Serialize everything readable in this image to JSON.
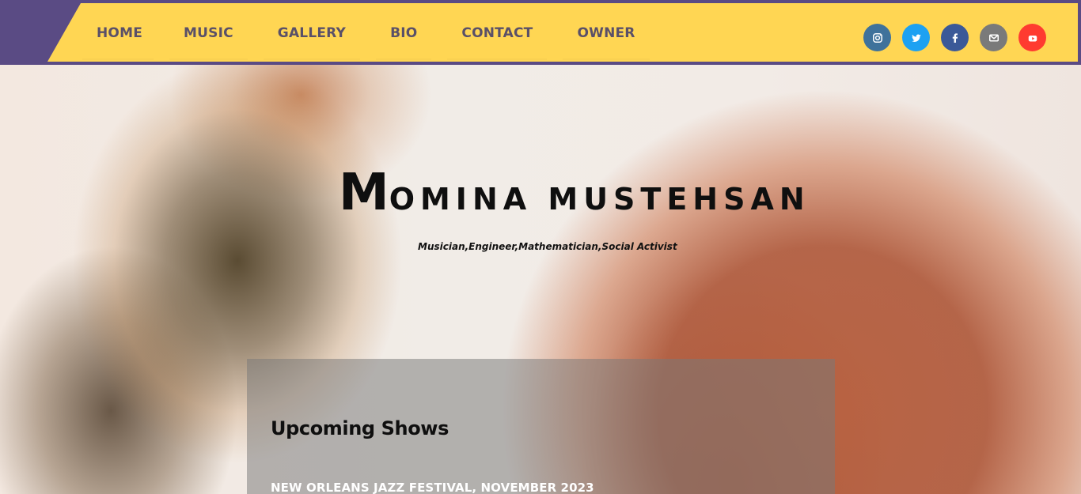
{
  "nav": {
    "items": [
      {
        "label": "HOME"
      },
      {
        "label": "MUSIC"
      },
      {
        "label": "GALLERY"
      },
      {
        "label": "BIO"
      },
      {
        "label": "CONTACT"
      },
      {
        "label": "OWNER"
      }
    ]
  },
  "social": {
    "items": [
      {
        "name": "instagram-icon",
        "color": "#3f729b"
      },
      {
        "name": "twitter-icon",
        "color": "#1da1f2"
      },
      {
        "name": "facebook-icon",
        "color": "#3b5998"
      },
      {
        "name": "mail-icon",
        "color": "#7a7a7a"
      },
      {
        "name": "youtube-icon",
        "color": "#ff3b30"
      }
    ]
  },
  "hero": {
    "title_initial": "M",
    "title_rest": "OMINA MUSTEHSAN",
    "tagline": "Musician,Engineer,Mathematician,Social Activist"
  },
  "shows": {
    "heading": "Upcoming Shows",
    "items": [
      {
        "label": "NEW ORLEANS JAZZ FESTIVAL, NOVEMBER 2023"
      }
    ]
  },
  "colors": {
    "nav_bar": "#ffd653",
    "nav_outer": "#5a4b84",
    "nav_text": "#5a5068",
    "panel": "rgba(120,120,120,0.52)"
  }
}
